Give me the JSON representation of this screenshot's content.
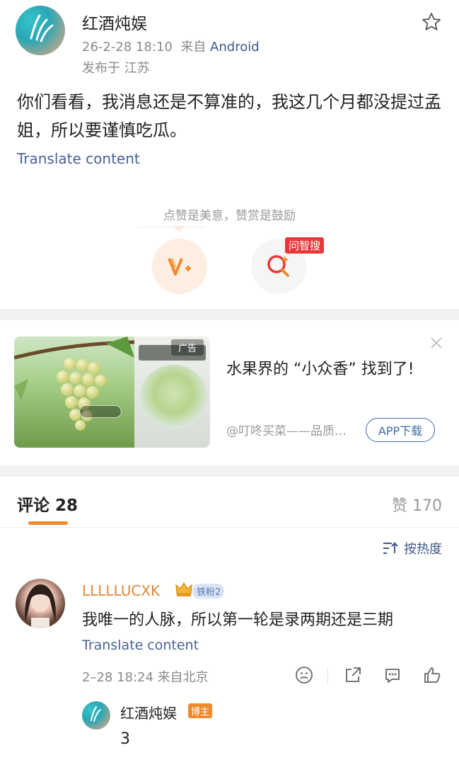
{
  "post": {
    "author": "红酒炖娱",
    "timestamp": "26-2-28 18:10",
    "source_prefix": "来自",
    "source": "Android",
    "location": "发布于 江苏",
    "content": "你们看看，我消息还是不算准的，我这几个月都没提过孟姐，所以要谨慎吃瓜。",
    "translate": "Translate content",
    "reward_hint": "点赞是美意，赞赏是鼓励",
    "search_badge": "问智搜"
  },
  "ad": {
    "label": "广告",
    "title": "水果界的 “小众香” 找到了!",
    "source": "@叮咚买菜——品质…",
    "button": "APP下载"
  },
  "comments_section": {
    "comments_label": "评论",
    "comments_count": "28",
    "likes_label": "赞",
    "likes_count": "170",
    "sort_label": "按热度"
  },
  "comment": {
    "user": "LLLLLUCXK",
    "fan_badge": "铁粉2",
    "text": "我唯一的人脉，所以第一轮是录两期还是三期",
    "translate": "Translate content",
    "meta": "2–28 18:24 来自北京"
  },
  "reply": {
    "user": "红酒炖娱",
    "badge": "博主",
    "text": "3"
  },
  "colors": {
    "accent_orange": "#f08a2c",
    "link_blue": "#4a6396",
    "username_orange": "#e0873b"
  }
}
